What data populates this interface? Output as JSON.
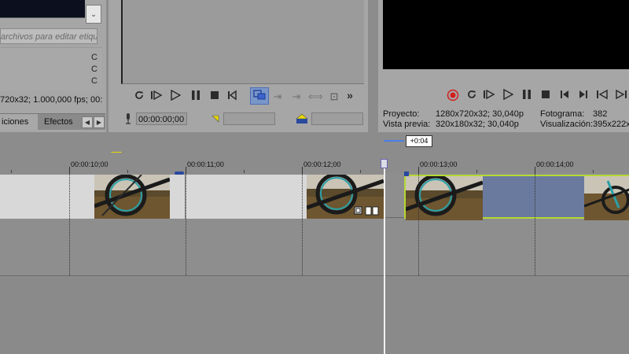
{
  "project_media": {
    "search_placeholder": "archivos para editar etiqu",
    "scroll_arrow": "⌄",
    "list_letters": [
      "C",
      "C",
      "C"
    ],
    "info": "720x32; 1.000,000 fps; 00:",
    "tabs": [
      "iciones",
      "Efectos"
    ],
    "tab_prev": "◀",
    "tab_next": "▶"
  },
  "trimmer": {
    "time": "00:00:00;00",
    "more_label": "»",
    "buttons": [
      "loop-icon",
      "play-from-start-icon",
      "play-icon",
      "pause-icon",
      "stop-icon",
      "go-to-start-icon",
      "create-subclip-icon",
      "add-to-timeline-start-icon",
      "add-to-timeline-end-icon",
      "fit-icon",
      "insert-icon"
    ]
  },
  "preview": {
    "project_label": "Proyecto:",
    "project_value": "1280x720x32; 30,040p",
    "preview_label": "Vista previa:",
    "preview_value": "320x180x32; 30,040p",
    "frame_label": "Fotograma:",
    "frame_value": "382",
    "display_label": "Visualización:",
    "display_value": "395x222x"
  },
  "timeline": {
    "offset_label": "+0:04",
    "ruler_labels": [
      "00:00:10;00",
      "00:00:11;00",
      "00:00:12;00",
      "00:00:13;00",
      "00:00:14;00"
    ]
  },
  "colors": {
    "panel": "#a6a6a6",
    "timeline_bg": "#8a8a8a",
    "clip_gray": "#d8d8d8",
    "clip_blue": "#6a7a9e",
    "clip_selected_border": "#b5d834",
    "playhead": "#f0f0f0",
    "accent_blue": "#4a7ee8",
    "record_red": "#d21e1e",
    "marker_yellow": "#e6d800"
  }
}
